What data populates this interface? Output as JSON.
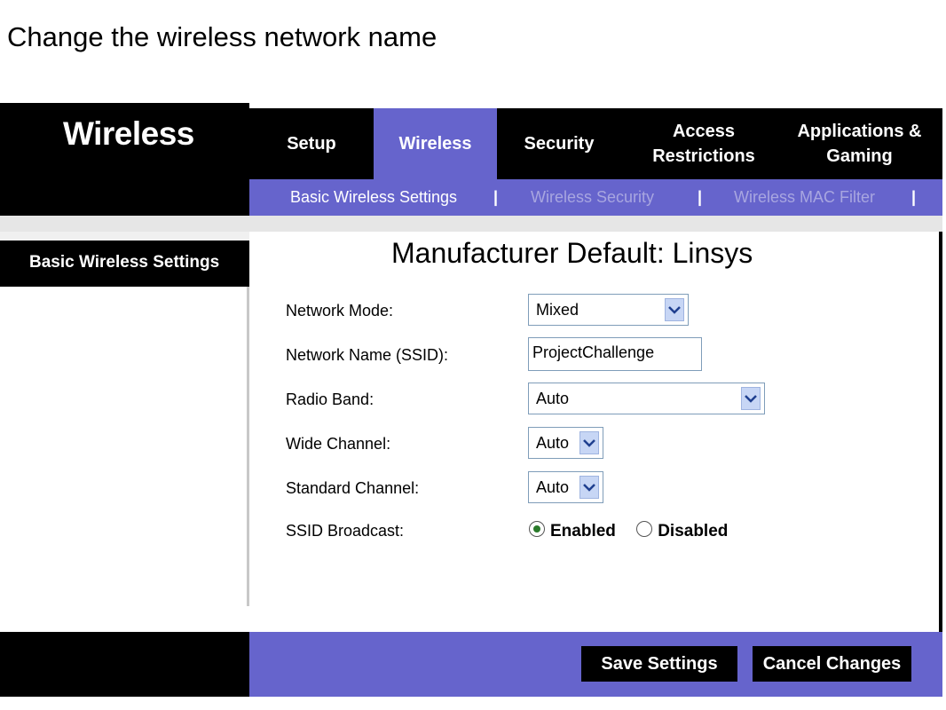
{
  "slide_title": "Change the wireless network name",
  "router": {
    "brand": "Wireless",
    "tabs": [
      {
        "label": "Setup",
        "active": false
      },
      {
        "label": "Wireless",
        "active": true
      },
      {
        "label": "Security",
        "active": false
      },
      {
        "label": "Access Restrictions",
        "active": false
      },
      {
        "label": "Applications & Gaming",
        "active": false
      }
    ],
    "subnav": {
      "items": [
        "Basic Wireless Settings",
        "Wireless Security",
        "Wireless MAC Filter"
      ],
      "separator": "|"
    },
    "side_label": "Basic Wireless Settings",
    "notice": "Manufacturer Default:  Linsys",
    "form": {
      "network_mode": {
        "label": "Network Mode:",
        "value": "Mixed"
      },
      "ssid": {
        "label": "Network Name (SSID):",
        "value": "ProjectChallenge"
      },
      "radio_band": {
        "label": "Radio Band:",
        "value": "Auto"
      },
      "wide_channel": {
        "label": "Wide Channel:",
        "value": "Auto"
      },
      "standard_channel": {
        "label": "Standard Channel:",
        "value": "Auto"
      },
      "ssid_broadcast": {
        "label": "SSID Broadcast:",
        "enabled": "Enabled",
        "disabled": "Disabled",
        "selected": "Enabled"
      }
    },
    "buttons": {
      "save": "Save Settings",
      "cancel": "Cancel Changes"
    },
    "colors": {
      "accent": "#6664cc",
      "header": "#000000"
    },
    "icons": {
      "dropdown": "chevron-down-icon",
      "radio": "radio-icon"
    }
  }
}
